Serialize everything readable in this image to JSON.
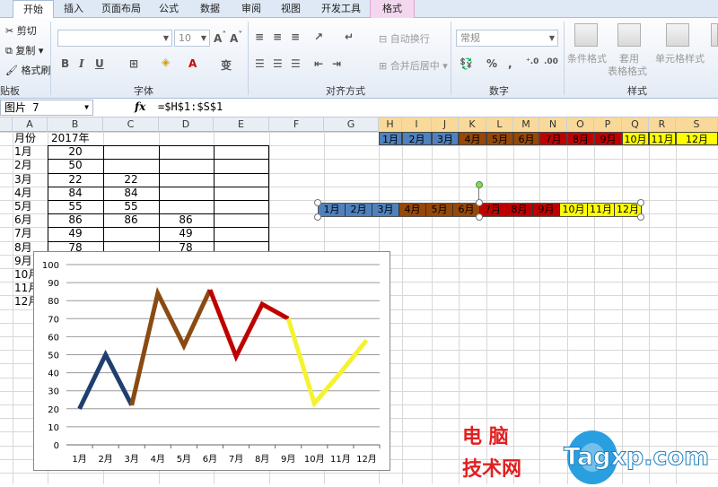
{
  "tabs": [
    "开始",
    "插入",
    "页面布局",
    "公式",
    "数据",
    "审阅",
    "视图",
    "开发工具",
    "格式"
  ],
  "ribbon": {
    "clipboard": {
      "cut": "剪切",
      "copy": "复制",
      "format_painter": "格式刷",
      "group": "贴板"
    },
    "font": {
      "size": "10",
      "group": "字体"
    },
    "alignment": {
      "wrap": "自动换行",
      "merge": "合并后居中",
      "group": "对齐方式"
    },
    "number": {
      "format": "常规",
      "percent": "%",
      "comma": ",",
      "group": "数字"
    },
    "styles": {
      "conditional": "条件格式",
      "apply": "套用",
      "table_format": "表格格式",
      "cell_styles": "单元格样式",
      "group": "样式"
    }
  },
  "formula_bar": {
    "name_box": "图片 7",
    "fx": "fx",
    "formula": "=$H$1:$S$1"
  },
  "columns": [
    "A",
    "B",
    "C",
    "D",
    "E",
    "F",
    "G",
    "H",
    "I",
    "J",
    "K",
    "L",
    "M",
    "N",
    "O",
    "P",
    "Q",
    "R",
    "S"
  ],
  "sheet": {
    "header_a": "月份",
    "header_b": "2017年",
    "rows": [
      {
        "month": "1月",
        "b": "20",
        "c": "",
        "d": ""
      },
      {
        "month": "2月",
        "b": "50",
        "c": "",
        "d": ""
      },
      {
        "month": "3月",
        "b": "22",
        "c": "22",
        "d": ""
      },
      {
        "month": "4月",
        "b": "84",
        "c": "84",
        "d": ""
      },
      {
        "month": "5月",
        "b": "55",
        "c": "55",
        "d": ""
      },
      {
        "month": "6月",
        "b": "86",
        "c": "86",
        "d": "86"
      },
      {
        "month": "7月",
        "b": "49",
        "c": "",
        "d": "49"
      },
      {
        "month": "8月",
        "b": "78",
        "c": "",
        "d": "78"
      },
      {
        "month": "9月",
        "b": "",
        "c": "",
        "d": ""
      },
      {
        "month": "10月",
        "b": "",
        "c": "",
        "d": ""
      },
      {
        "month": "11月",
        "b": "",
        "c": "",
        "d": ""
      },
      {
        "month": "12月",
        "b": "",
        "c": "",
        "d": ""
      }
    ]
  },
  "month_strip": [
    "1月",
    "2月",
    "3月",
    "4月",
    "5月",
    "6月",
    "7月",
    "8月",
    "9月",
    "10月",
    "11月",
    "12月"
  ],
  "colors": {
    "q1": "#4f81bd",
    "q2": "#974706",
    "q3": "#c00000",
    "q4": "#ffff00",
    "line_q1": "#1f3f6e",
    "line_q2": "#8a4a12",
    "line_q3": "#c00000",
    "line_q4": "#f5f230"
  },
  "chart_data": {
    "type": "line",
    "categories": [
      "1月",
      "2月",
      "3月",
      "4月",
      "5月",
      "6月",
      "7月",
      "8月",
      "9月",
      "10月",
      "11月",
      "12月"
    ],
    "values": [
      20,
      50,
      22,
      84,
      55,
      86,
      49,
      78,
      70,
      23,
      40,
      58
    ],
    "segments": [
      {
        "from": 0,
        "to": 2,
        "color": "#1f3f6e"
      },
      {
        "from": 2,
        "to": 5,
        "color": "#8a4a12"
      },
      {
        "from": 5,
        "to": 8,
        "color": "#c00000"
      },
      {
        "from": 8,
        "to": 11,
        "color": "#f5f230"
      }
    ],
    "ylim": [
      0,
      100
    ],
    "yticks": [
      0,
      10,
      20,
      30,
      40,
      50,
      60,
      70,
      80,
      90,
      100
    ],
    "grid": true,
    "title": "",
    "xlabel": "",
    "ylabel": ""
  },
  "watermark": {
    "line1": "电 脑",
    "line2": "技术网",
    "brand": "Tagxp.com"
  }
}
